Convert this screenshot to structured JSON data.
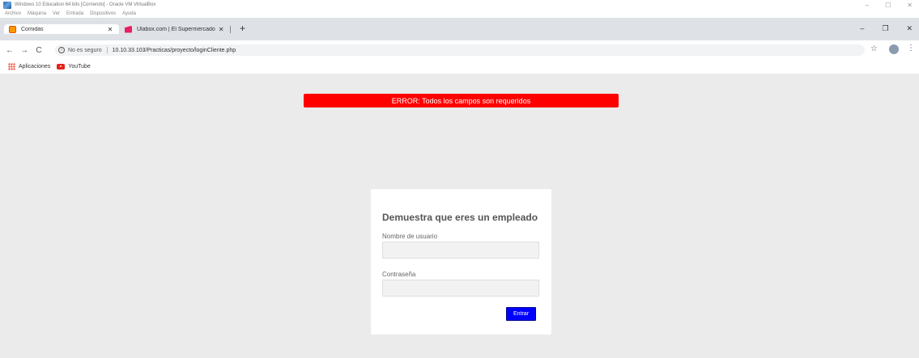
{
  "vm_window": {
    "title": "Windows 10 Education 64 bits [Corriendo] - Oracle VM VirtualBox",
    "menu": [
      "Archivo",
      "Máquina",
      "Ver",
      "Entrada",
      "Dispositivos",
      "Ayuda"
    ],
    "controls": {
      "minimize": "–",
      "restore": "☐",
      "close": "✕"
    }
  },
  "browser": {
    "tabs": [
      {
        "label": "Comidas",
        "close": "✕",
        "favicon": "orange-square-favicon",
        "active": true
      },
      {
        "label": "Ulabox.com | El Supermercado O",
        "close": "✕",
        "favicon": "ulabox-favicon",
        "active": false
      }
    ],
    "new_tab": "+",
    "window_controls": {
      "minimize": "–",
      "restore": "❐",
      "close": "✕"
    },
    "nav": {
      "back": "←",
      "forward": "→",
      "reload": "C"
    },
    "address": {
      "security_text": "No es seguro",
      "url": "10.10.33.103/Practicas/proyecto/loginCliente.php"
    },
    "bookmarks": [
      {
        "label": "Aplicaciones",
        "icon": "apps-grid-icon"
      },
      {
        "label": "YouTube",
        "icon": "youtube-icon"
      }
    ]
  },
  "page": {
    "error_message": "ERROR: Todos los campos son requeridos",
    "error_color": "#ff0000",
    "login": {
      "title": "Demuestra que eres un empleado",
      "username_label": "Nombre de usuario",
      "username_value": "",
      "password_label": "Contraseña",
      "password_value": "",
      "submit_label": "Entrar",
      "submit_color": "#0000ff"
    }
  }
}
